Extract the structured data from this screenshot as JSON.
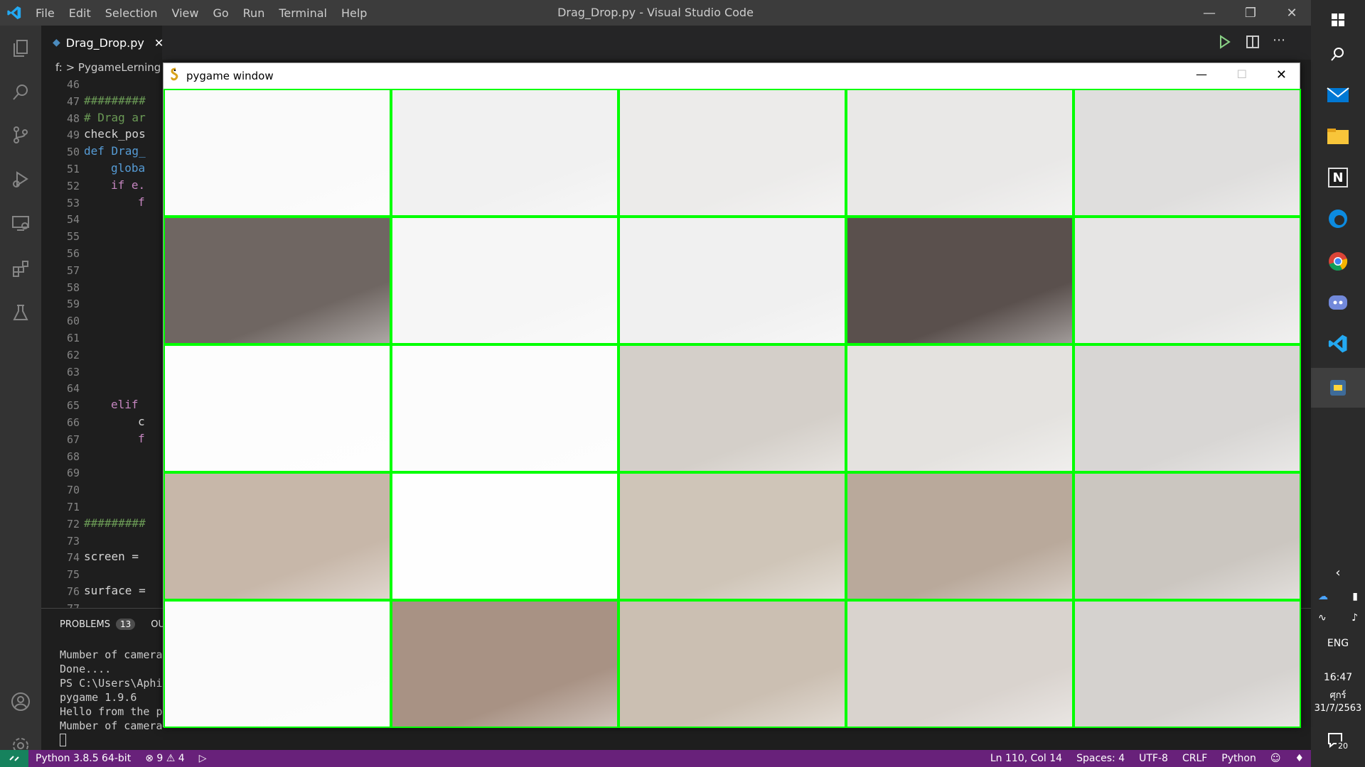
{
  "window": {
    "title": "Drag_Drop.py - Visual Studio Code",
    "menu": [
      "File",
      "Edit",
      "Selection",
      "View",
      "Go",
      "Run",
      "Terminal",
      "Help"
    ]
  },
  "editor": {
    "tab_label": "Drag_Drop.py",
    "breadcrumb": "f: > PygameLerning",
    "line_numbers": [
      "46",
      "47",
      "48",
      "49",
      "50",
      "51",
      "52",
      "53",
      "54",
      "55",
      "56",
      "57",
      "58",
      "59",
      "60",
      "61",
      "62",
      "63",
      "64",
      "65",
      "66",
      "67",
      "68",
      "69",
      "70",
      "71",
      "72",
      "73",
      "74",
      "75",
      "76",
      "77"
    ],
    "code_lines": [
      {
        "n": "47",
        "text": "#########",
        "color": "#6a9955",
        "indent": 0
      },
      {
        "n": "48",
        "text": "# Drag ar",
        "color": "#6a9955",
        "indent": 0
      },
      {
        "n": "49",
        "text": "check_pos",
        "color": "#d4d4d4",
        "indent": 0
      },
      {
        "n": "50",
        "text": "def Drag_",
        "color": "#569cd6",
        "indent": 0
      },
      {
        "n": "51",
        "text": "globa",
        "color": "#569cd6",
        "indent": 1
      },
      {
        "n": "52",
        "text": "if e.",
        "color": "#c586c0",
        "indent": 1
      },
      {
        "n": "53",
        "text": "f",
        "color": "#c586c0",
        "indent": 2
      },
      {
        "n": "65",
        "text": "elif",
        "color": "#c586c0",
        "indent": 1
      },
      {
        "n": "66",
        "text": "c",
        "color": "#d4d4d4",
        "indent": 2
      },
      {
        "n": "67",
        "text": "f",
        "color": "#c586c0",
        "indent": 2
      },
      {
        "n": "72",
        "text": "#########",
        "color": "#6a9955",
        "indent": 0
      },
      {
        "n": "74",
        "text": "screen = ",
        "color": "#d4d4d4",
        "indent": 0
      },
      {
        "n": "76",
        "text": "surface =",
        "color": "#d4d4d4",
        "indent": 0
      }
    ]
  },
  "panel": {
    "problems_label": "PROBLEMS",
    "problems_count": "13",
    "output_label_partial": "OU",
    "terminal_lines": [
      "Mumber of camera",
      "Done....",
      "PS C:\\Users\\Aphi",
      "pygame 1.9.6",
      "Hello from the p",
      "Mumber of camera"
    ]
  },
  "statusbar": {
    "python": "Python 3.8.5 64-bit",
    "errors": "9",
    "warnings": "4",
    "position": "Ln 110, Col 14",
    "spaces": "Spaces: 4",
    "encoding": "UTF-8",
    "eol": "CRLF",
    "language": "Python"
  },
  "pygame": {
    "title": "pygame window",
    "grid_color": "#00ff00",
    "tiles": [
      "#fafafa",
      "#f1f1f1",
      "#ecebea",
      "#e9e8e7",
      "#dfdedd",
      "#6f6662",
      "#f6f6f6",
      "#f0f0f0",
      "#5a504d",
      "#e6e5e4",
      "#fdfdfd",
      "#fcfcfc",
      "#d4cfc9",
      "#e4e2df",
      "#d8d6d4",
      "#c7b7a9",
      "#fefefe",
      "#cfc5b8",
      "#b9a99b",
      "#cbc6c0",
      "#fbfbfb",
      "#a89284",
      "#cbbfb2",
      "#d9d3ce",
      "#d5d2cf"
    ]
  },
  "taskbar": {
    "lang": "ENG",
    "time": "16:47",
    "day": "ศุกร์",
    "date": "31/7/2563",
    "notifications": "20"
  }
}
